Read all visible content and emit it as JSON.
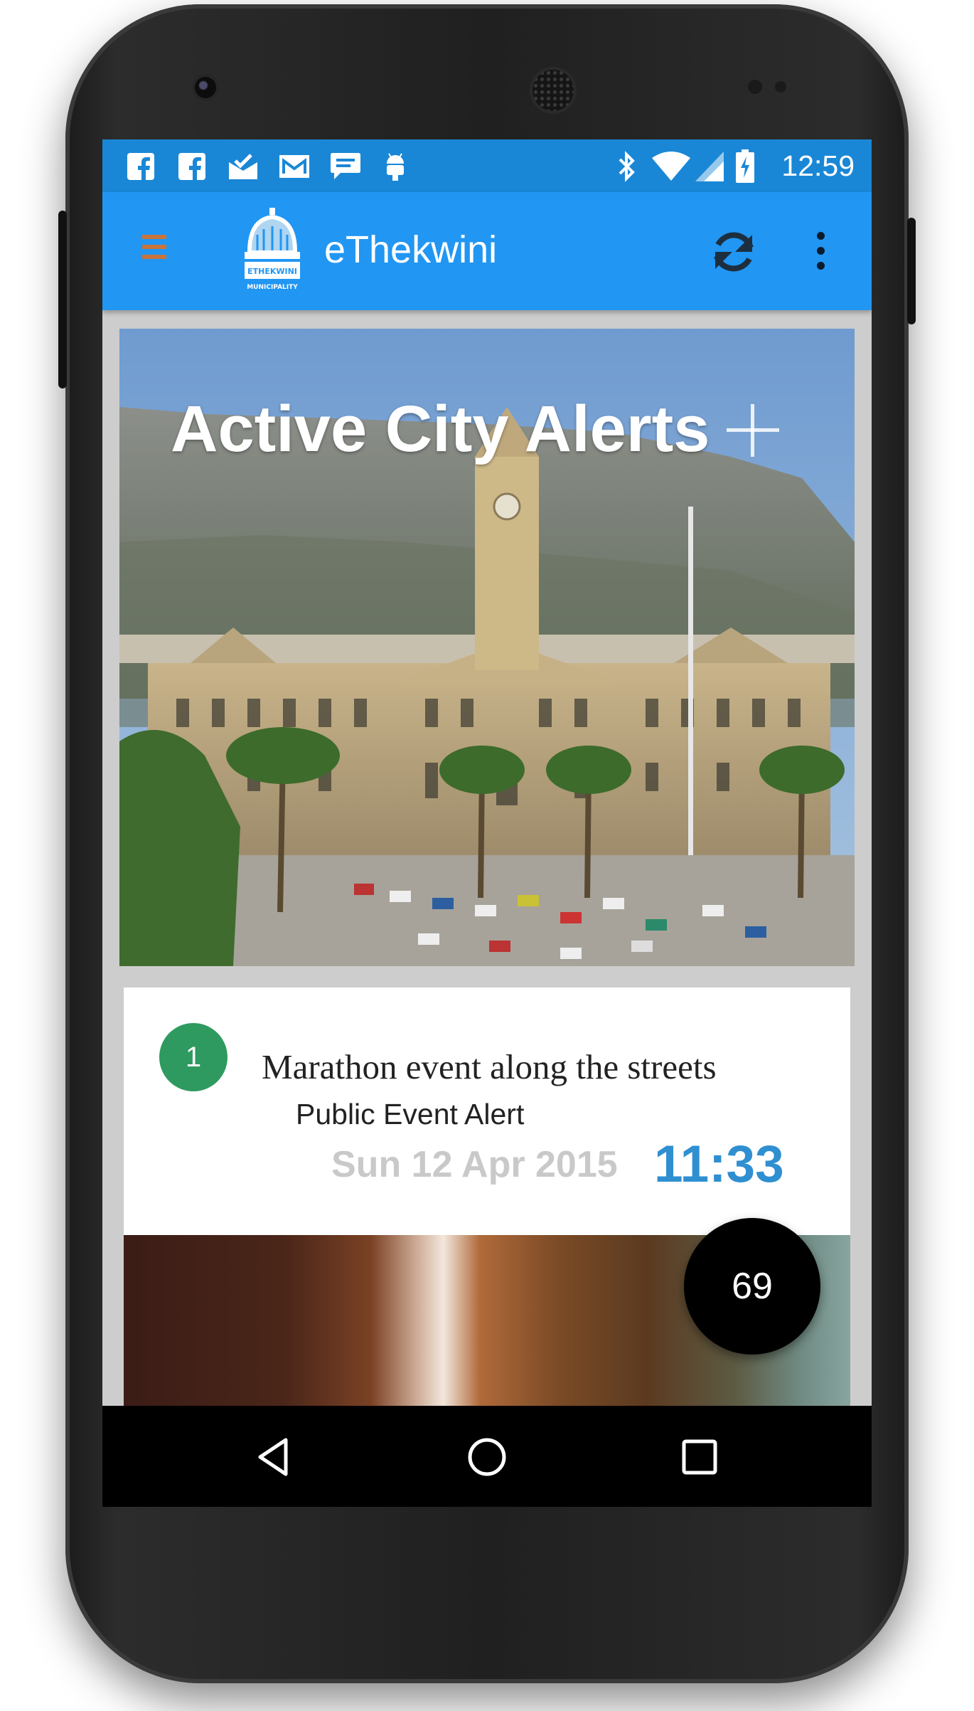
{
  "status_bar": {
    "time": "12:59",
    "left_icons": [
      "facebook-icon",
      "facebook-icon",
      "mail-check-icon",
      "gmail-icon",
      "chat-icon",
      "android-icon"
    ],
    "right_icons": [
      "bluetooth-icon",
      "wifi-icon",
      "signal-icon",
      "battery-charging-icon"
    ]
  },
  "app_bar": {
    "title": "eThekwini",
    "logo_text": "ETHEKWINI MUNICIPALITY",
    "icons": [
      "menu-icon",
      "refresh-icon",
      "more-vert-icon"
    ],
    "primary_color": "#2196f3",
    "status_color": "#1a87d6"
  },
  "hero": {
    "title": "Active City Alerts",
    "add_icon": "plus-icon"
  },
  "alerts": [
    {
      "number": "1",
      "title": "Marathon event along the streets",
      "type": "Public Event Alert",
      "date": "Sun 12 Apr 2015",
      "time": "11:33",
      "badge_color": "#2e9a5f",
      "time_color": "#2f8fd1"
    }
  ],
  "fab": {
    "count": "69"
  },
  "nav_bar": {
    "icons": [
      "back-icon",
      "home-icon",
      "recents-icon"
    ]
  }
}
